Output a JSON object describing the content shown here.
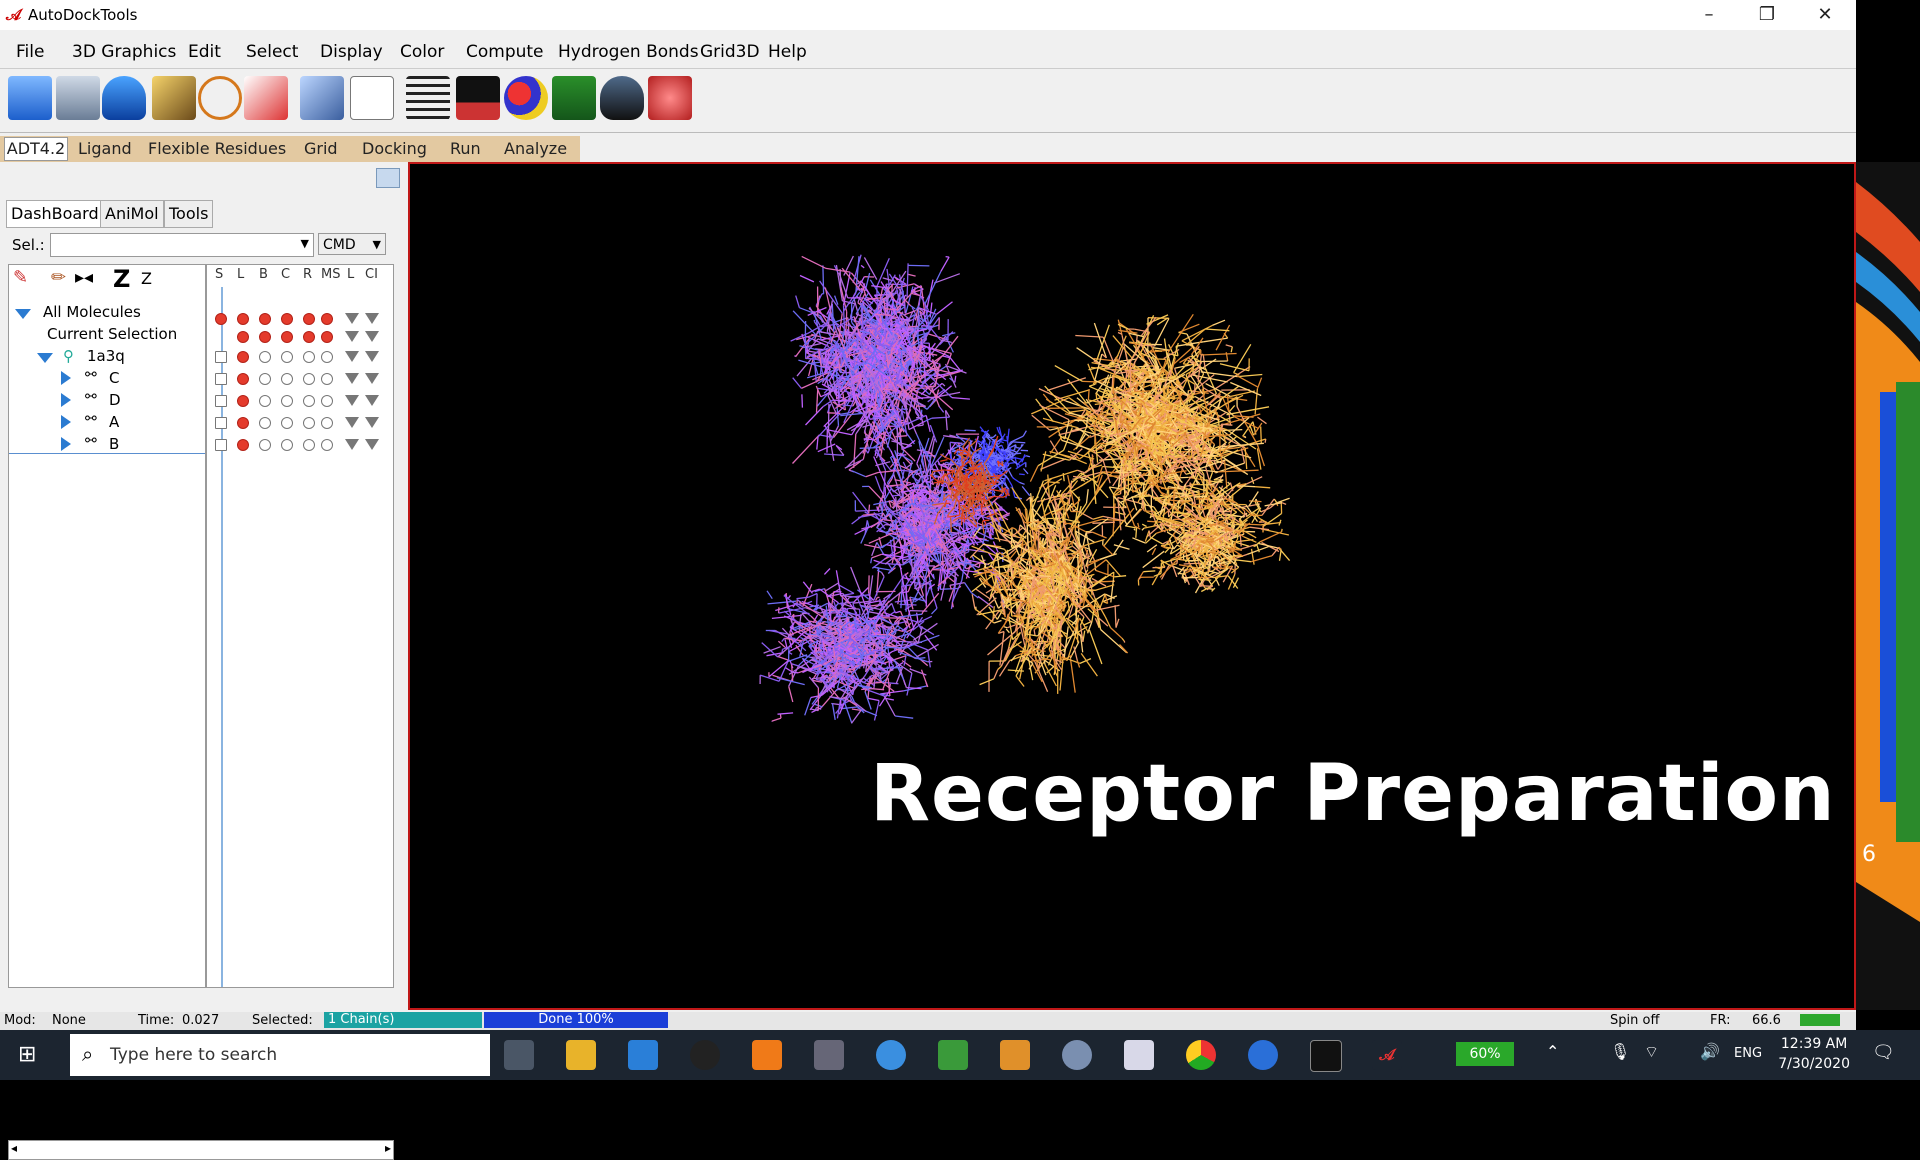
{
  "window": {
    "title": "AutoDockTools",
    "min": "–",
    "max": "❐",
    "close": "✕"
  },
  "menu": [
    "File",
    "3D Graphics",
    "Edit",
    "Select",
    "Display",
    "Color",
    "Compute",
    "Hydrogen Bonds",
    "Grid3D",
    "Help"
  ],
  "plugin_tabs": {
    "adt": "ADT4.2",
    "items": [
      "Ligand",
      "Flexible Residues",
      "Grid",
      "Docking",
      "Run",
      "Analyze"
    ]
  },
  "left_tabs": [
    "DashBoard",
    "AniMol",
    "Tools"
  ],
  "selection": {
    "label": "Sel.:",
    "cmd": "CMD"
  },
  "tree": {
    "all": "All Molecules",
    "current": "Current Selection",
    "molecule": "1a3q",
    "chains": [
      "C",
      "D",
      "A",
      "B"
    ]
  },
  "columns": [
    "S",
    "L",
    "B",
    "C",
    "R",
    "MS",
    "L",
    "CI"
  ],
  "viewer": {
    "caption": "Receptor Preparation"
  },
  "statusbar": {
    "mod": "Mod:",
    "mod_val": "None",
    "time": "Time:",
    "time_val": "0.027",
    "selected": "Selected:",
    "selected_val": "1 Chain(s)",
    "done": "Done 100%",
    "spin": "Spin off",
    "fr": "FR:",
    "fr_val": "66.6"
  },
  "taskbar": {
    "search_placeholder": "Type here to search",
    "battery": "60%",
    "lang": "ENG",
    "time": "12:39 AM",
    "date": "7/30/2020"
  },
  "side_number": "6"
}
